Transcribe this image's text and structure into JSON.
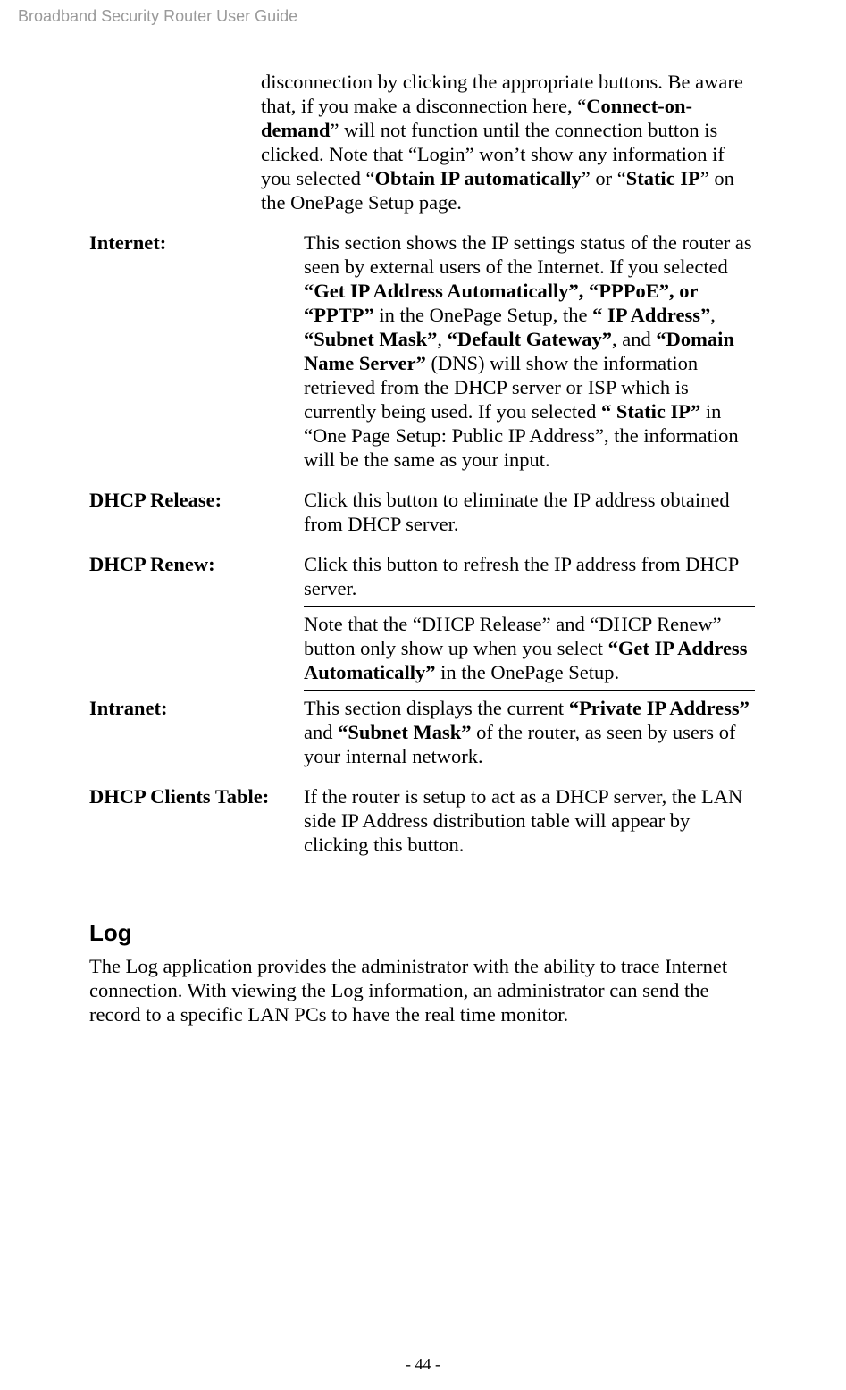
{
  "header": {
    "title": "Broadband Security Router User Guide"
  },
  "intro": {
    "part1": "disconnection by clicking the appropriate buttons. Be aware that, if you make a disconnection here, “",
    "b1": "Connect-on-demand",
    "part2": "” will not function until the connection button is clicked. Note that “Login” won’t show any information if you selected “",
    "b2": "Obtain IP automatically",
    "part3": "” or “",
    "b3": "Static IP",
    "part4": "” on the OnePage Setup page."
  },
  "rows": {
    "internet": {
      "label": "Internet:",
      "p1": "This section shows the IP settings status of the router as seen by external users of the Internet. If you selected ",
      "b1": "“Get IP Address Automatically”, “PPPoE”, or “PPTP”",
      "p2": " in the OnePage Setup, the ",
      "b2": "“ IP Address”",
      "p3": ", ",
      "b3": "“Subnet Mask”",
      "p4": ", ",
      "b4": "“Default Gateway”",
      "p5": ", and ",
      "b5": "“Domain Name Server”",
      "p6": " (DNS) will show the information retrieved from the DHCP server or ISP which is currently being used. If you selected ",
      "b6": "“ Static IP”",
      "p7": " in “One Page Setup: Public IP Address”, the information will be the same as your input."
    },
    "dhcp_release": {
      "label": "DHCP Release:",
      "text": "Click this button to eliminate the IP address obtained from DHCP server."
    },
    "dhcp_renew": {
      "label": "DHCP Renew:",
      "text": "Click this button to refresh the IP address from DHCP server."
    },
    "note": {
      "p1": "Note that the “DHCP Release” and “DHCP Renew” button only show up when you select ",
      "b1": "“Get IP Address Automatically”",
      "p2": " in the OnePage Setup."
    },
    "intranet": {
      "label": "Intranet:",
      "p1": "This section displays the current ",
      "b1": "“Private IP Address”",
      "p2": " and ",
      "b2": "“Subnet Mask”",
      "p3": " of the router, as seen by users of your internal network."
    },
    "dhcp_clients": {
      "label": "DHCP Clients Table:",
      "text": "If the router is setup to act as a DHCP server, the LAN side IP Address distribution table will appear by clicking this button."
    }
  },
  "log": {
    "heading": "Log",
    "body": "The Log application provides the administrator with the ability to trace Internet connection. With viewing the Log information, an administrator can send the record to a specific LAN PCs to have the real time monitor."
  },
  "footer": {
    "text": "- 44 -"
  }
}
